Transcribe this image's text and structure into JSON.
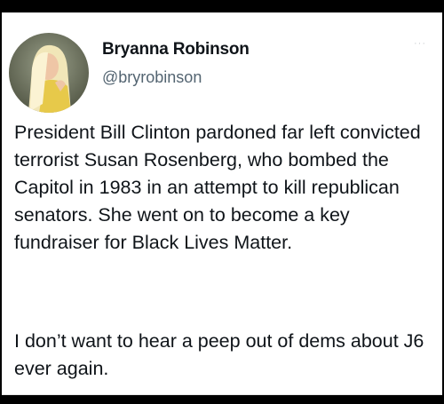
{
  "tweet": {
    "author_name": "Bryanna Robinson",
    "author_handle": "@bryrobinson",
    "more_icon": "···",
    "paragraphs": [
      "President Bill Clinton pardoned far left convicted terrorist Susan Rosenberg, who bombed the Capitol in 1983 in an attempt to kill republican senators. She went on to become a key fundraiser for Black Lives Matter.",
      "I don’t want to hear a peep out of dems about J6 ever again."
    ]
  },
  "colors": {
    "background": "#000000",
    "card": "#ffffff",
    "text": "#0f1419",
    "secondary_text": "#536471"
  }
}
